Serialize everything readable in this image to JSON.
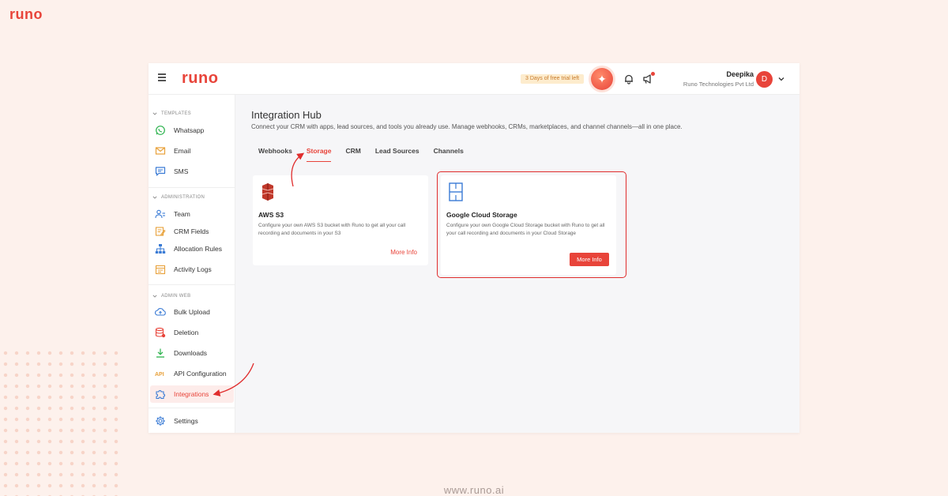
{
  "brand": {
    "logo": "runo",
    "footer_url": "www.runo.ai"
  },
  "topbar": {
    "logo": "runo",
    "trial_badge": "3 Days of free trial left",
    "user": {
      "name": "Deepika",
      "company": "Runo Technologies Pvt Ltd",
      "avatar_initial": "D"
    }
  },
  "sidebar": {
    "sections": [
      {
        "label": "TEMPLATES",
        "items": [
          "Whatsapp",
          "Email",
          "SMS"
        ]
      },
      {
        "label": "ADMINISTRATION",
        "items": [
          "Team",
          "CRM Fields",
          "Allocation Rules",
          "Activity Logs"
        ]
      },
      {
        "label": "ADMIN WEB",
        "items": [
          "Bulk Upload",
          "Deletion",
          "Downloads",
          "API Configuration",
          "Integrations"
        ]
      }
    ],
    "settings": "Settings",
    "active_item": "Integrations"
  },
  "main": {
    "title": "Integration Hub",
    "subtitle": "Connect your CRM with apps, lead sources, and tools you already use. Manage webhooks, CRMs, marketplaces, and channel channels—all in one place.",
    "tabs": [
      "Webhooks",
      "Storage",
      "CRM",
      "Lead Sources",
      "Channels"
    ],
    "active_tab": "Storage",
    "cards": [
      {
        "title": "AWS S3",
        "description": "Configure your own AWS S3 bucket with Runo to get all your call recording and documents in your S3",
        "action": "More Info"
      },
      {
        "title": "Google Cloud Storage",
        "description": "Configure your own Google Cloud Storage bucket with Runo to get all your call recording and documents in your Cloud Storage",
        "action": "More Info"
      }
    ]
  },
  "colors": {
    "accent": "#e8443a",
    "background": "#fdf1ec",
    "annotation": "#e02d2d"
  }
}
